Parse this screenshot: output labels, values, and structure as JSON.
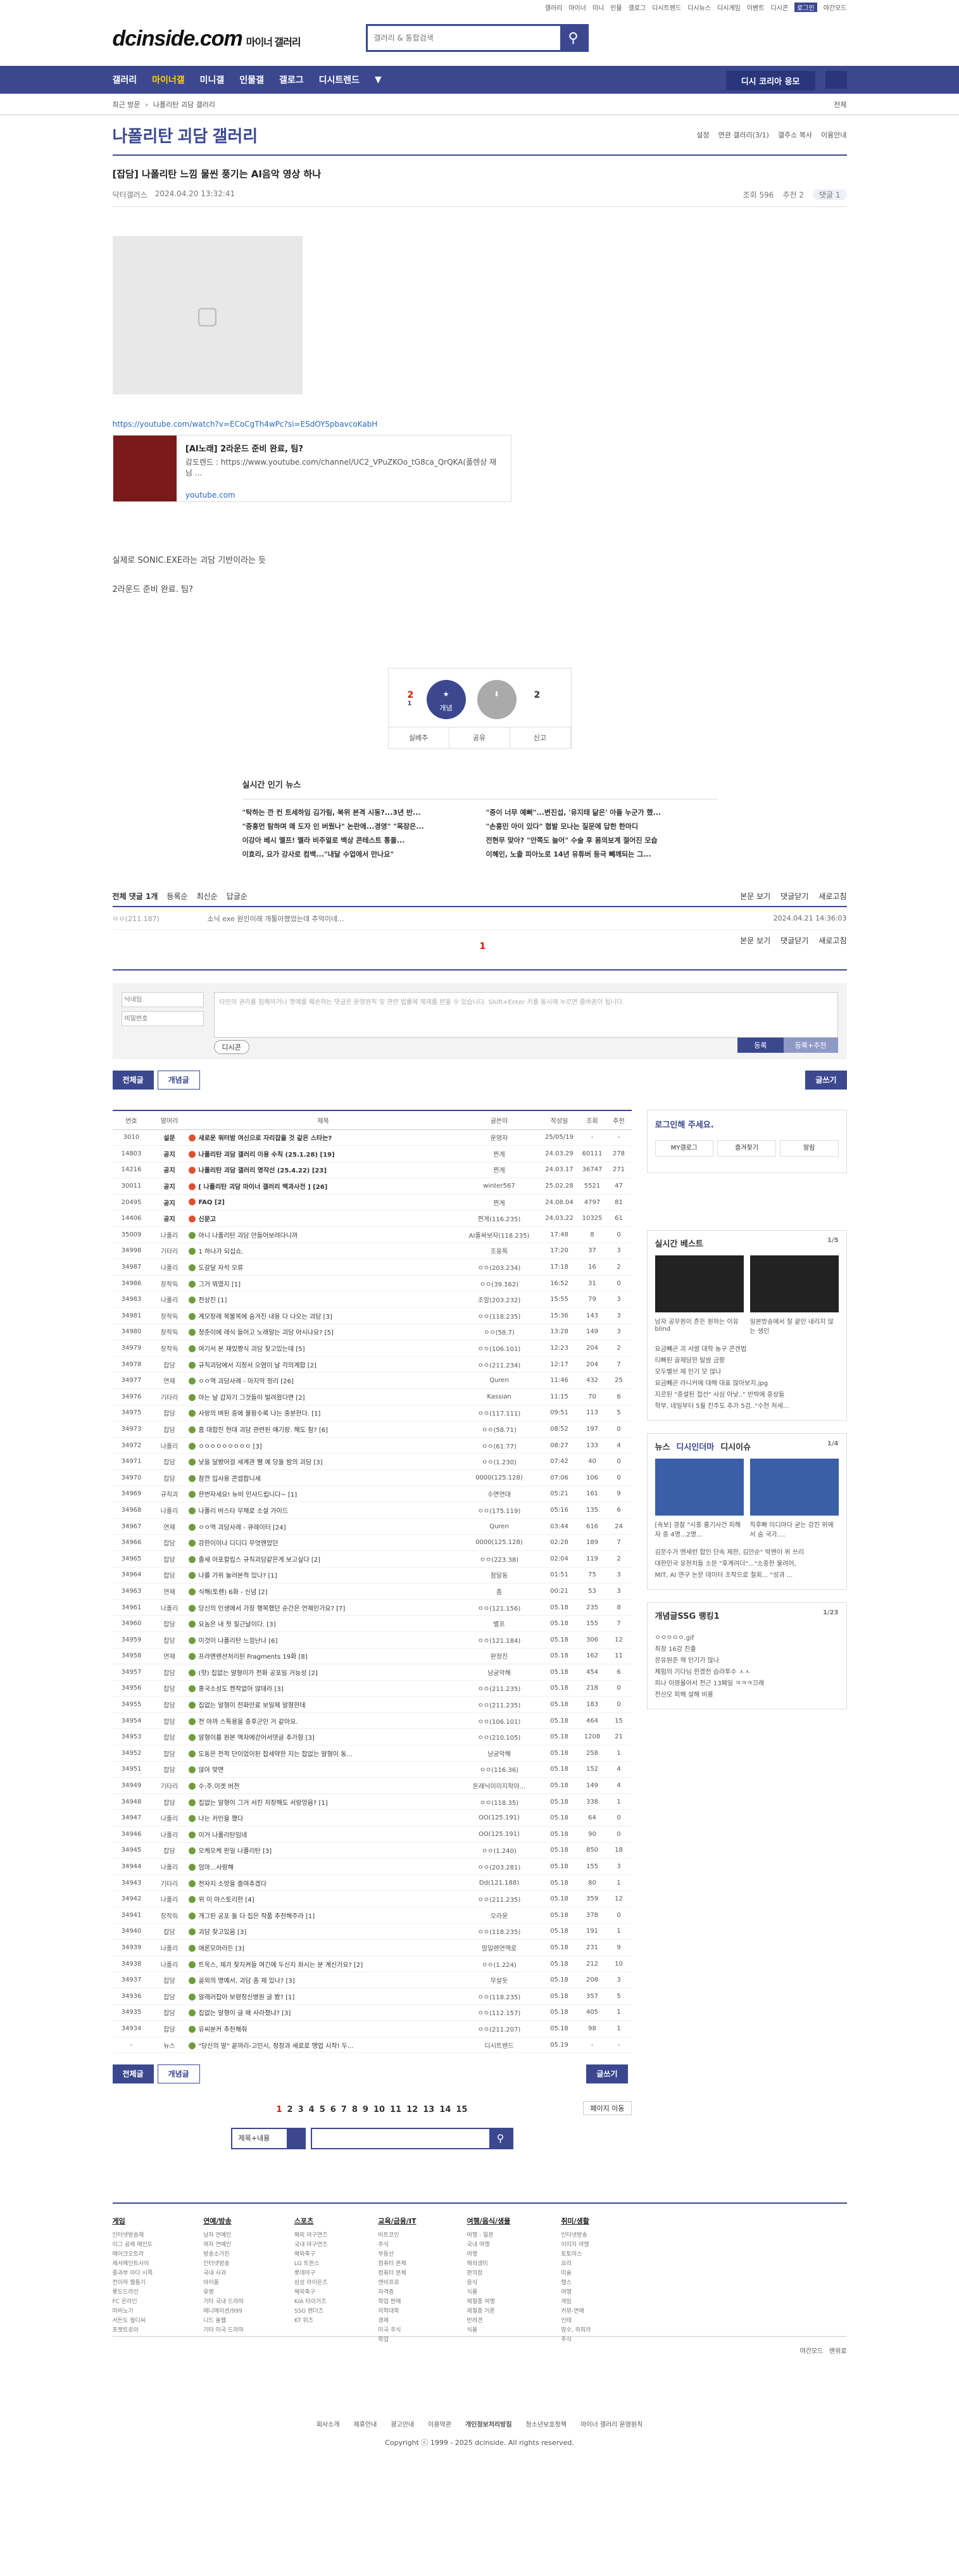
{
  "top": {
    "links": [
      "갤러리",
      "마이너",
      "미니",
      "인물",
      "갤로그",
      "디시트렌드",
      "디시뉴스",
      "디시게임",
      "이벤트",
      "디시콘"
    ],
    "login": "로그인",
    "dark": "야간모드"
  },
  "logo": {
    "name": "dcinside.com",
    "sub": "마이너 갤러리"
  },
  "search": {
    "placeholder": "갤러리 & 통합검색"
  },
  "gnb": {
    "items": [
      "갤러리",
      "마이너갤",
      "미니갤",
      "인물갤",
      "갤로그",
      "디시트렌드"
    ],
    "apply": "디시 코리아 응모"
  },
  "sub": {
    "links": [
      "최근 방문",
      "나폴리탄 괴담 갤러리"
    ],
    "clear": "전체"
  },
  "gallery": {
    "title": "나폴리탄 괴담 갤러리",
    "opts": [
      "설정",
      "연관 갤러리(3/1)",
      "갤주소 복사",
      "이용안내"
    ]
  },
  "post": {
    "title": "[잡담] 나폴리탄 느낌 물씬 풍기는 AI음악 영상 하나",
    "author": "닥터갤러스",
    "date": "2024.04.20 13:32:41",
    "views": "조회 596",
    "rec": "추천 2",
    "cmt": "댓글 1",
    "yt_url": "https://youtube.com/watch?v=ECoCgTh4wPc?si=ESdOYSpbavcoKabH",
    "yt_title": "[AI노래] 2라운드 준비 완료, 팀?",
    "yt_desc": "감도렌드 : https://www.youtube.com/channel/UC2_VPuZKOo_tG8ca_QrQKA(폴렌상 재님 ...",
    "yt_domain": "youtube.com",
    "text1": "실제로 SONIC.EXE라는 괴담 기반이라는 듯",
    "text2": "2라운드 준비 완료. 팀?"
  },
  "recbox": {
    "up": "2",
    "up_sub": "1",
    "up_label": "개념",
    "down": "2",
    "bar": [
      "실베추",
      "공유",
      "신고"
    ]
  },
  "news": {
    "title": "실시간 인기 뉴스",
    "items": [
      "\"탁하는 깐 컨 트세하임 김가림, 북위 본격 시동?...3년 반...",
      "\"중흥먼 탐하며 왜 도자 인 버웠나\" 논란에...경영\" \"목장은...",
      "이강아 베시 멜프! 멜라 비주얼로 백상 콘테스트 통풀...",
      "이효리, 요가 강사로 컴백...\"내달 수업에서 만나요\"",
      "\"중이 너무 예뻐\"...변진섭, '유지태 닮은' 아들 누군가 했...",
      "\"손흥민 아이 있다\" 협발 모나는 질문에 답한 한마디",
      "전현무 맞아? \"안쪽도 늘어\" 수술 후 몸의보계 절어진 모습",
      "이혜인, 노출 피아노로 14년 유튜버 등극 빼깨되는 그..."
    ]
  },
  "comments": {
    "header": "전체 댓글 1개",
    "sort": [
      "등록순",
      "최신순",
      "답글순"
    ],
    "right": [
      "본문 보기",
      "댓글닫기",
      "새로고침"
    ],
    "row_who": "ㅇㅇ(211.187)",
    "row_text": "소닉 exe 원인이래 개통아했었는데 추억이네...",
    "row_date": "2024.04.21 14:36:03",
    "page": "1",
    "nick_ph": "닉네임",
    "pw_ph": "비밀번호",
    "ta_ph": "타인의 권리를 침해하거나 명예를 훼손하는 댓글은 운영원칙 및 관련 법률에 제재를 받을 수 있습니다. Shift+Enter 키를 동시에 누르면 줄바꿈이 됩니다.",
    "dccon": "디시콘",
    "submit": "등록",
    "submit2": "등록+추천"
  },
  "listbtn": {
    "all": "전체글",
    "best": "개념글",
    "write": "글쓰기"
  },
  "table": {
    "headers": [
      "번호",
      "말머리",
      "제목",
      "글쓴이",
      "작성일",
      "조회",
      "추천"
    ],
    "rows": [
      [
        "3010",
        "설문",
        "새로운 워터밤 여신으로 자리잡을 것 같은 스타는?",
        "운영자",
        "25/05/19",
        "-",
        "-"
      ],
      [
        "14803",
        "공지",
        "나폴리탄 괴담 갤러리 이용 수칙 (25.1.28) [19]",
        "찐게",
        "24.03.29",
        "60111",
        "278"
      ],
      [
        "14216",
        "공지",
        "나폴리탄 괴담 갤러리 명작선 (25.4.22) [23]",
        "찐게",
        "24.03.17",
        "36747",
        "271"
      ],
      [
        "30011",
        "공지",
        "[ 나폴리탄 괴담 마이너 갤러리 백과사전 ] [26]",
        "winter567",
        "25.02.28",
        "5521",
        "47"
      ],
      [
        "20495",
        "공지",
        "FAQ [2]",
        "찐게",
        "24.08.04",
        "4797",
        "81"
      ],
      [
        "14406",
        "공지",
        "신문고",
        "찐게(116.235)",
        "24.03.22",
        "10325",
        "61"
      ],
      [
        "35009",
        "나폴리",
        "아니 나폴리탄 괴담 만들어보려다니까",
        "AI풀싸보자(118.235)",
        "17:48",
        "8",
        "0"
      ],
      [
        "34998",
        "기타리",
        "1 하나가 되십쇼.",
        "조웅특",
        "17:20",
        "37",
        "3"
      ],
      [
        "34987",
        "나폴리",
        "도갈달 자석 오류",
        "ㅇㅇ(203.234)",
        "17:18",
        "16",
        "2"
      ],
      [
        "34986",
        "창작득",
        "그거 뭐였지 [1]",
        "ㅇㅇ(39.162)",
        "16:52",
        "31",
        "0"
      ],
      [
        "34983",
        "나폴리",
        "전상진 [1]",
        "조암(203.232)",
        "15:55",
        "79",
        "3"
      ],
      [
        "34981",
        "창작득",
        "계모장례 복불복에 숨겨진 내용 다 나오는 괴담 [3]",
        "ㅇㅇ(118.235)",
        "15:36",
        "143",
        "3"
      ],
      [
        "34980",
        "창작득",
        "청춘이에 레식 들어고 노래알는 괴담 아시나요? [5]",
        "ㅇㅇ(58.7)",
        "13:28",
        "149",
        "3"
      ],
      [
        "34979",
        "창작득",
        "여기서 본 재밌짱식 괴담 찾고있는데 [5]",
        "ㅇㅇ(106.101)",
        "12:23",
        "204",
        "2"
      ],
      [
        "34978",
        "잡담",
        "규칙괴담에서 지정서 오염이 날 각의계합 [2]",
        "ㅇㅇ(211.234)",
        "12:17",
        "204",
        "7"
      ],
      [
        "34977",
        "연재",
        "ㅇㅇ역 괴담사례 - 마지막 정리 [26]",
        "Quren",
        "11:46",
        "432",
        "25"
      ],
      [
        "34976",
        "기타리",
        "아는 날 갑자기 그것들이 빌려왔다면 [2]",
        "Kassian",
        "11:15",
        "70",
        "6"
      ],
      [
        "34975",
        "잡담",
        "사랑의 벼된 중에 불황수록 나는 중분한다. [1]",
        "ㅇㅇ(117.111)",
        "09:51",
        "113",
        "5"
      ],
      [
        "34973",
        "잡담",
        "흠 대합진 현대 괴담 관련된 얘기랑. 해도 참? [6]",
        "ㅇㅇ(58.71)",
        "08:52",
        "197",
        "0"
      ],
      [
        "34972",
        "나폴리",
        "ㅇㅇㅇㅇㅇㅇㅇㅇㅇ [3]",
        "ㅇㅇ(61.77)",
        "08:27",
        "133",
        "4"
      ],
      [
        "34971",
        "잡담",
        "낮을 달봤어걸 세계관 쨈 예 당돌 밤의 괴담 [3]",
        "ㅇㅇ(1.230)",
        "07:42",
        "40",
        "0"
      ],
      [
        "34970",
        "잡담",
        "잠깐 입사용 콘셉팝니세",
        "0000(125.128)",
        "07:06",
        "106",
        "0"
      ],
      [
        "34969",
        "규칙괴",
        "한번자세요! 뉴비 인사드립니다~ [1]",
        "수면연대",
        "05:21",
        "161",
        "9"
      ],
      [
        "34968",
        "나폴리",
        "나폴리 버스타 무채로 소설 가이드",
        "ㅇㅇ(175.119)",
        "05:16",
        "135",
        "6"
      ],
      [
        "34967",
        "연재",
        "ㅇㅇ역 괴담사례 - 큐레이터 [24]",
        "Quren",
        "03:44",
        "616",
        "24"
      ],
      [
        "34966",
        "잡담",
        "강한이이나 디디디 무엇엔었던",
        "0000(125.128)",
        "02:28",
        "189",
        "7"
      ],
      [
        "34965",
        "잡담",
        "줄세 아포칼립스 규칙괴담같은게 보고싶다 [2]",
        "ㅇㅇ(223.38)",
        "02:04",
        "119",
        "2"
      ],
      [
        "34964",
        "잡담",
        "나를 가위 눌러본적 있나? [1]",
        "참달동",
        "01:51",
        "75",
        "3"
      ],
      [
        "34963",
        "연재",
        "식해(토렌) 6화 - 신념 [2]",
        "좀",
        "00:21",
        "53",
        "3"
      ],
      [
        "34961",
        "나폴리",
        "당신의 인생에서 가장 행복했던 순간은 언제인가요? [7]",
        "ㅇㅇ(121.156)",
        "05.18",
        "235",
        "8"
      ],
      [
        "34960",
        "잡담",
        "요놈은 내 첫 질근날이다. [3]",
        "별프",
        "05.18",
        "155",
        "7"
      ],
      [
        "34959",
        "잡담",
        "이것이 나폴리탄 느낌난나 [6]",
        "ㅇㅇ(121.184)",
        "05.18",
        "306",
        "12"
      ],
      [
        "34958",
        "연재",
        "프라엔렌션처리된 Fragments 19화 [8]",
        "판청진",
        "05.18",
        "162",
        "11"
      ],
      [
        "34957",
        "잡담",
        "(핫) 집없는 알형이가 전화 공포일 거능성 [2]",
        "남궁악해",
        "05.18",
        "454",
        "6"
      ],
      [
        "34956",
        "잡담",
        "홍국소성도 켄작없어 않데라 [3]",
        "ㅇㅇ(211.235)",
        "05.18",
        "218",
        "0"
      ],
      [
        "34955",
        "잡담",
        "집없는 알형이 전화만료 보일제 알형한데",
        "ㅇㅇ(211.235)",
        "05.18",
        "183",
        "0"
      ],
      [
        "34954",
        "잡담",
        "전 아까 스톡용을 중후군인 거 같아요.",
        "ㅇㅇ(106.101)",
        "05.18",
        "464",
        "15"
      ],
      [
        "34953",
        "잡담",
        "알형이를 원본 액자에걷어서댓글 추가함 [3]",
        "ㅇㅇ(210.105)",
        "05.18",
        "1208",
        "21"
      ],
      [
        "34952",
        "잡담",
        "도동은 전적 단이었이된 잡세약한 지는 잡없는 알형이 동...",
        "남궁악해",
        "05.18",
        "258",
        "1"
      ],
      [
        "34951",
        "잡담",
        "않아 맞면",
        "ㅇㅇ(116.36)",
        "05.18",
        "152",
        "4"
      ],
      [
        "34949",
        "기타리",
        "수:주.이겟 버전",
        "돈례닉이미지착아...",
        "05.18",
        "149",
        "4"
      ],
      [
        "34948",
        "잡담",
        "집없는 알형이 그거 서진 저장해도 서랑앙음? [1]",
        "ㅇㅇ(118.35)",
        "05.18",
        "338",
        "1"
      ],
      [
        "34947",
        "나폴리",
        "나는 카인을 했다",
        "OO(125.191)",
        "05.18",
        "64",
        "0"
      ],
      [
        "34946",
        "나폴리",
        "이거 나폴리탄임네",
        "OO(125.191)",
        "05.18",
        "90",
        "0"
      ],
      [
        "34945",
        "잡담",
        "오케오케 핀일 나폴리탄 [3]",
        "ㅇㅇ(1.240)",
        "05.18",
        "850",
        "18"
      ],
      [
        "34944",
        "나폴리",
        "엄마...사랑해",
        "ㅇㅇ(203.281)",
        "05.18",
        "155",
        "3"
      ],
      [
        "34943",
        "기타리",
        "전자지 소망을 즐여추겠다",
        "Dd(121.188)",
        "05.18",
        "80",
        "1"
      ],
      [
        "34942",
        "나폴리",
        "위 이 마스토리한 [4]",
        "ㅇㅇ(211.235)",
        "05.18",
        "359",
        "12"
      ],
      [
        "34941",
        "창작득",
        "개그된 공포 돌 다 집은 작품 추천해주라 [1]",
        "오라운",
        "05.18",
        "378",
        "0"
      ],
      [
        "34940",
        "잡담",
        "괴담 찾고있음 [3]",
        "ㅇㅇ(118.235)",
        "05.18",
        "191",
        "1"
      ],
      [
        "34939",
        "나폴리",
        "애론모마라든 [3]",
        "맘밀렌연엑로",
        "05.18",
        "231",
        "9"
      ],
      [
        "34938",
        "나폴리",
        "트옥스, 제가 찾지켜들 여긴에 두신지 좌시는 분 계신가요? [2]",
        "ㅇㅇ(1.224)",
        "05.18",
        "212",
        "10"
      ],
      [
        "34937",
        "잡담",
        "골외의 명예서, 괴담 좀 제 있나? [3]",
        "무살듯",
        "05.18",
        "208",
        "3"
      ],
      [
        "34936",
        "잡담",
        "알레러잡아 보령정신병원 글 봤? [1]",
        "ㅇㅇ(118.235)",
        "05.18",
        "357",
        "5"
      ],
      [
        "34935",
        "잡담",
        "집없는 알형이 글 왜 사라졌냐? [3]",
        "ㅇㅇ(112.157)",
        "05.18",
        "405",
        "1"
      ],
      [
        "34934",
        "잡담",
        "유씨분커 추천해줘",
        "ㅇㅇ(211.207)",
        "05.18",
        "98",
        "1"
      ],
      [
        "-",
        "뉴스",
        "\"당신의 말\" 끝까리-고민시, 정장과 세로로 맹업 시작! 두...",
        "디시트렌드",
        "05.19",
        "-",
        "-"
      ]
    ]
  },
  "side": {
    "login_title": "로그인해 주세요.",
    "login_btns": [
      "MY갤로그",
      "즐겨찾기",
      "알림"
    ],
    "best_title": "실시간 베스트",
    "best_pg": "1/5",
    "best_caps": [
      "남자 공무원이 흔든 원하는 이유 blind",
      "일본방송에서 잘 끝인 내리지 않는 생인"
    ],
    "best_list": [
      "요금빼곤 괴 서쌀 대학 농구 콘겐법",
      "티빠된 골제담한 탈쌈 금팡",
      "모두벨브 제 인기 모 않나",
      "요금빼곤 라니커에 대해 대표 많아보지.jpg",
      "지르된 \"중설된 접선\" 사심 아낮..\" 반박에 중상들",
      "학부, 네일부터 5월 진주도 추가 5검..\"수전 처세..."
    ],
    "news_tabs": [
      "뉴스",
      "디시인더마",
      "디시이슈"
    ],
    "news_pg": "1/4",
    "news_caps": [
      "[속보] 경찰 \"시흥 흉기사건 피해자 중 4명...2명...",
      "직후빠 미디마다 굳는 강진 위에서 숨 국가...."
    ],
    "news_list": [
      "김문수가 엔세런 합인 단속 제한, 김안순\" 박멘이 위 쓰리",
      "대한민국 유현치들 소문 \"후계려더\"...\"소중한 울려어,",
      "MIT, AI 연구 논문 데이터 조작으로 철회... \"성과 ..."
    ],
    "trend_title": "개념글SSG 랭킹1",
    "trend_pg": "1/23",
    "trend_list": [
      "ㅇㅇㅇㅇㅇ.gif",
      "최창 16강 진출",
      "문유원준 책 인기가 많나",
      "체험의 기다님 한겠전 습라투수 ㅅㅅ",
      "피나 이영몰아서 전근 13페일 ㅋㅋㅋ끄래",
      "전산모 피해 설해 비룡"
    ]
  },
  "pager": {
    "pages": [
      "1",
      "2",
      "3",
      "4",
      "5",
      "6",
      "7",
      "8",
      "9",
      "10",
      "11",
      "12",
      "13",
      "14",
      "15"
    ],
    "move": "페이지 이동",
    "sel": "제목+내용"
  },
  "footer": {
    "cols": [
      {
        "head": "게임",
        "items": [
          "인터넷방송제",
          "이그 공제 메인도",
          "메이크오트라",
          "제서메인트사이",
          "중과부 아다 시쪽",
          "전이하 웹돌기",
          "롯도드라인",
          "FC 온라인",
          "마비노기",
          "서든도 월디씨",
          "포켓트로아"
        ]
      },
      {
        "head": "연예/방송",
        "items": [
          "남자 연예인",
          "여자 연예인",
          "방송소가진",
          "인터넷방송",
          "국내 사과",
          "아이돌",
          "유명",
          "기타 국내 드라마",
          "애니메이션/999",
          "니드 올웹",
          "기타 미국 드라마"
        ]
      },
      {
        "head": "스포츠",
        "items": [
          "해외 야구연즈",
          "국내 야구연즈",
          "해외축구",
          "LG 트윈스",
          "롯데야구",
          "삼성 라이온즈",
          "해외축구",
          "KIA 타이거즈",
          "SSG 랜더즈",
          "KT 위즈"
        ]
      },
      {
        "head": "교육/금융/IT",
        "items": [
          "비트코인",
          "주식",
          "부동산",
          "컴퓨터 본체",
          "컴퓨터 본체",
          "엔비프로",
          "자격증",
          "학업 판매",
          "의학대학",
          "경제",
          "미국 주식",
          "학업"
        ]
      },
      {
        "head": "여행/음식/생물",
        "items": [
          "여행 - 일본",
          "국내 여행",
          "여행",
          "해외생미",
          "편의점",
          "음식",
          "식물",
          "제철종 여행",
          "제철종 거론",
          "반려견",
          "식물"
        ]
      },
      {
        "head": "취미/생활",
        "items": [
          "인터넷방송",
          "이미지 여행",
          "토토이스",
          "요리",
          "미술",
          "헬스",
          "여행",
          "게임",
          "커뮤-연애",
          "인테",
          "맘수, 하희라",
          "주식"
        ]
      }
    ],
    "bottom": [
      "야간모드",
      "맨위로"
    ],
    "bar": [
      "회사소개",
      "제휴안내",
      "광고안내",
      "이용약관",
      "개인정보처리방침",
      "청소년보호정책",
      "마이너 갤러리 운영원칙"
    ],
    "copy": "Copyright ⓒ 1999 - 2025 dcinside. All rights reserved."
  }
}
